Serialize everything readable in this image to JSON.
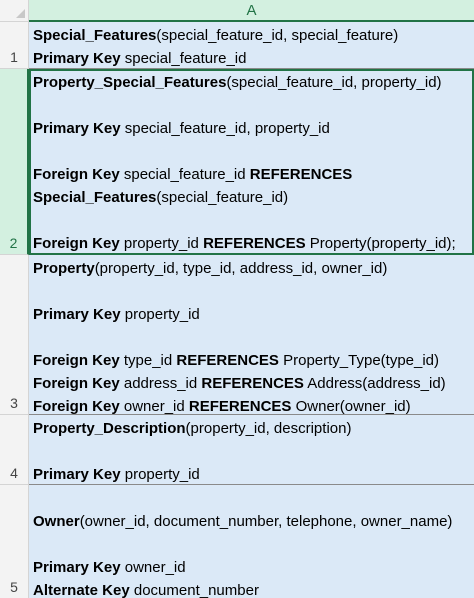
{
  "column_header": "A",
  "rows": [
    {
      "num": "1",
      "lines": [
        [
          [
            "Special_Features",
            true
          ],
          [
            "(special_feature_id, special_feature)",
            false
          ]
        ],
        [
          [
            "Primary Key",
            true
          ],
          [
            " special_feature_id",
            false
          ]
        ]
      ]
    },
    {
      "num": "2",
      "lines": [
        [
          [
            "Property_Special_Features",
            true
          ],
          [
            "(special_feature_id, property_id)",
            false
          ]
        ],
        [],
        [
          [
            "Primary Key",
            true
          ],
          [
            " special_feature_id, property_id",
            false
          ]
        ],
        [],
        [
          [
            "Foreign Key",
            true
          ],
          [
            " special_feature_id ",
            false
          ],
          [
            "REFERENCES",
            true
          ]
        ],
        [
          [
            "Special_Features",
            true
          ],
          [
            "(special_feature_id)",
            false
          ]
        ],
        [],
        [
          [
            "Foreign Key",
            true
          ],
          [
            " property_id ",
            false
          ],
          [
            "REFERENCES",
            true
          ],
          [
            " Property(property_id);",
            false
          ]
        ]
      ]
    },
    {
      "num": "3",
      "lines": [
        [
          [
            "Property",
            true
          ],
          [
            "(property_id, type_id, address_id, owner_id)",
            false
          ]
        ],
        [],
        [
          [
            "Primary Key",
            true
          ],
          [
            " property_id",
            false
          ]
        ],
        [],
        [
          [
            "Foreign Key",
            true
          ],
          [
            " type_id ",
            false
          ],
          [
            "REFERENCES",
            true
          ],
          [
            " Property_Type(type_id)",
            false
          ]
        ],
        [
          [
            "Foreign Key",
            true
          ],
          [
            " address_id ",
            false
          ],
          [
            "REFERENCES",
            true
          ],
          [
            " Address(address_id)",
            false
          ]
        ],
        [
          [
            "Foreign Key",
            true
          ],
          [
            " owner_id ",
            false
          ],
          [
            "REFERENCES",
            true
          ],
          [
            " Owner(owner_id)",
            false
          ]
        ]
      ]
    },
    {
      "num": "4",
      "lines": [
        [
          [
            "Property_Description",
            true
          ],
          [
            "(property_id, description)",
            false
          ]
        ],
        [],
        [
          [
            "Primary Key",
            true
          ],
          [
            " property_id",
            false
          ]
        ]
      ]
    },
    {
      "num": "5",
      "lines": [
        [],
        [
          [
            "Owner",
            true
          ],
          [
            "(owner_id, document_number, telephone, owner_name)",
            false
          ]
        ],
        [],
        [
          [
            "Primary Key",
            true
          ],
          [
            " owner_id",
            false
          ]
        ],
        [
          [
            "Alternate Key",
            true
          ],
          [
            " document_number",
            false
          ]
        ]
      ]
    }
  ]
}
